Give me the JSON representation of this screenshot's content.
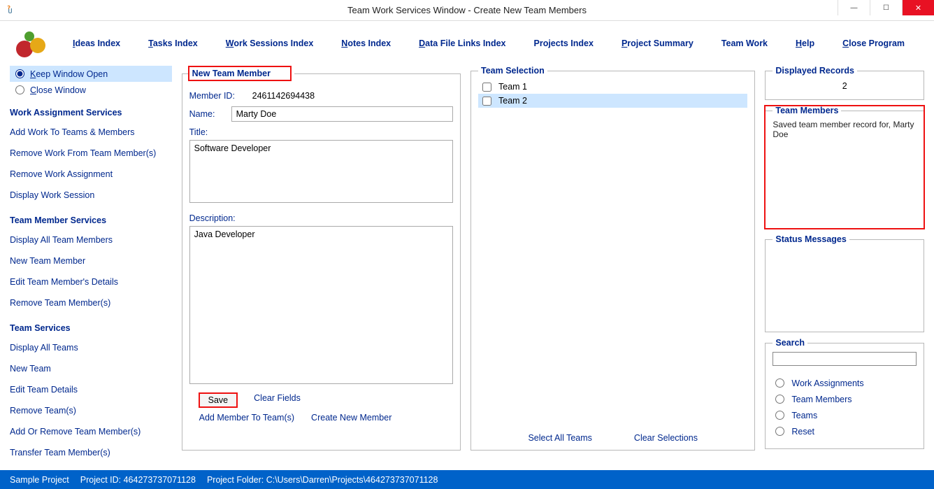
{
  "window": {
    "title": "Team Work Services Window - Create New Team Members"
  },
  "menubar": {
    "ideas": "Ideas Index",
    "tasks": "Tasks Index",
    "work_sessions": "Work Sessions Index",
    "notes": "Notes Index",
    "data_file": "Data File Links Index",
    "projects": "Projects Index",
    "project_summary": "Project Summary",
    "team_work": "Team Work",
    "help": "Help",
    "close": "Close Program"
  },
  "sidebar": {
    "keep_open": "Keep Window Open",
    "close_window": "Close Window",
    "work_assignment_h": "Work Assignment Services",
    "work_assignment": [
      "Add Work To Teams & Members",
      "Remove Work From Team Member(s)",
      "Remove Work Assignment",
      "Display Work Session"
    ],
    "team_member_h": "Team Member Services",
    "team_member": [
      "Display All Team Members",
      "New Team Member",
      "Edit Team Member's Details",
      "Remove Team Member(s)"
    ],
    "team_h": "Team Services",
    "team": [
      "Display All Teams",
      "New Team",
      "Edit Team Details",
      "Remove Team(s)",
      "Add Or Remove Team Member(s)",
      "Transfer Team Member(s)"
    ]
  },
  "form": {
    "legend": "New Team Member",
    "member_id_label": "Member ID:",
    "member_id": "2461142694438",
    "name_label": "Name:",
    "name_value": "Marty Doe",
    "title_label": "Title:",
    "title_value": "Software Developer",
    "desc_label": "Description:",
    "desc_value": "Java Developer",
    "save": "Save",
    "clear": "Clear Fields",
    "add_member": "Add Member To Team(s)",
    "create_new": "Create New Member"
  },
  "teams": {
    "legend": "Team Selection",
    "items": [
      "Team 1",
      "Team 2"
    ],
    "select_all": "Select All Teams",
    "clear_sel": "Clear Selections"
  },
  "right": {
    "disp_legend": "Displayed Records",
    "disp_count": "2",
    "tm_legend": "Team Members",
    "tm_msg": "Saved team member record for, Marty Doe",
    "status_legend": "Status Messages",
    "search_legend": "Search",
    "search_opts": [
      "Work Assignments",
      "Team Members",
      "Teams",
      "Reset"
    ]
  },
  "statusbar": {
    "project_name": "Sample Project",
    "project_id": "Project ID: 464273737071128",
    "project_folder": "Project Folder: C:\\Users\\Darren\\Projects\\464273737071128"
  }
}
